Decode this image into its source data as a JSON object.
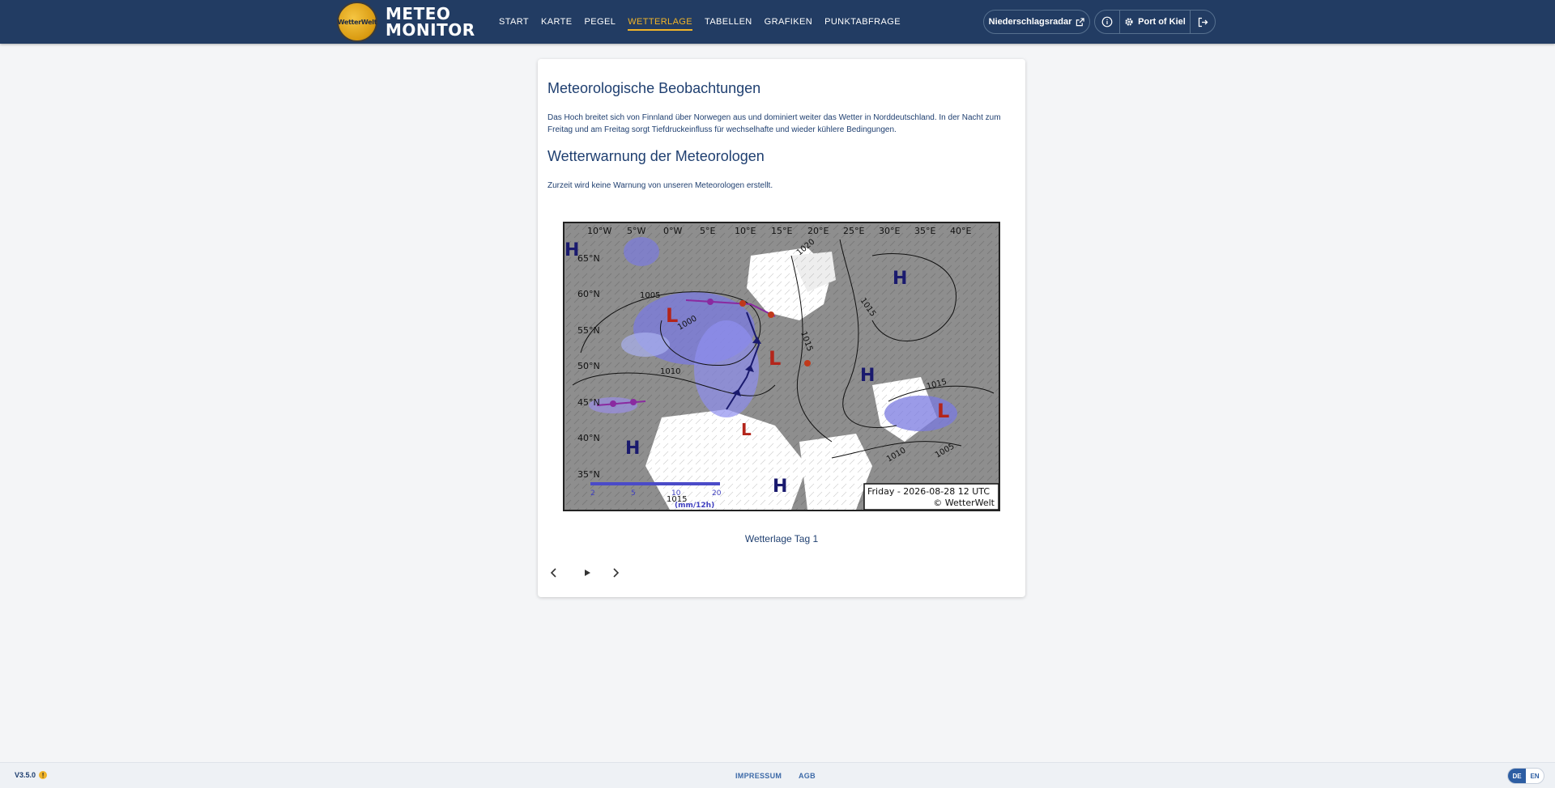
{
  "header": {
    "logo_text": "WetterWelt",
    "brand_line1": "METEO",
    "brand_line2": "MONITOR",
    "nav": [
      {
        "label": "START",
        "active": false
      },
      {
        "label": "KARTE",
        "active": false
      },
      {
        "label": "PEGEL",
        "active": false
      },
      {
        "label": "WETTERLAGE",
        "active": true
      },
      {
        "label": "TABELLEN",
        "active": false
      },
      {
        "label": "GRAFIKEN",
        "active": false
      },
      {
        "label": "PUNKTABFRAGE",
        "active": false
      }
    ],
    "radar_label": "Niederschlagsradar",
    "location_label": "Port of Kiel"
  },
  "main": {
    "obs_title": "Meteorologische Beobachtungen",
    "obs_text": "Das Hoch breitet sich von Finnland über Norwegen aus und dominiert weiter das Wetter in Norddeutschland. In der Nacht zum Freitag und am Freitag sorgt Tiefdruckeinfluss für wechselhafte und wieder kühlere Bedingungen.",
    "warn_title": "Wetterwarnung der Meteorologen",
    "warn_text": "Zurzeit wird keine Warnung von unseren Meteorologen erstellt.",
    "map": {
      "lon_labels": [
        "10°W",
        "5°W",
        "0°W",
        "5°E",
        "10°E",
        "15°E",
        "20°E",
        "25°E",
        "30°E",
        "35°E",
        "40°E"
      ],
      "lat_labels": [
        "65°N",
        "60°N",
        "55°N",
        "50°N",
        "45°N",
        "40°N",
        "35°N"
      ],
      "isobars": [
        "1005",
        "1000",
        "1010",
        "1015",
        "1020",
        "1015",
        "1015",
        "1010",
        "1005",
        "1015"
      ],
      "scale_ticks": [
        "2",
        "5",
        "10",
        "20"
      ],
      "scale_unit": "(mm/12h)",
      "timestamp": "Friday - 2026-08-28 12 UTC",
      "copyright": "© WetterWelt"
    },
    "caption": "Wetterlage Tag 1"
  },
  "footer": {
    "version": "V3.5.0",
    "links": [
      "IMPRESSUM",
      "AGB"
    ],
    "lang": [
      "DE",
      "EN"
    ]
  },
  "colors": {
    "header_bg": "#223c63",
    "accent": "#f0b429",
    "text": "#1f3f70"
  }
}
